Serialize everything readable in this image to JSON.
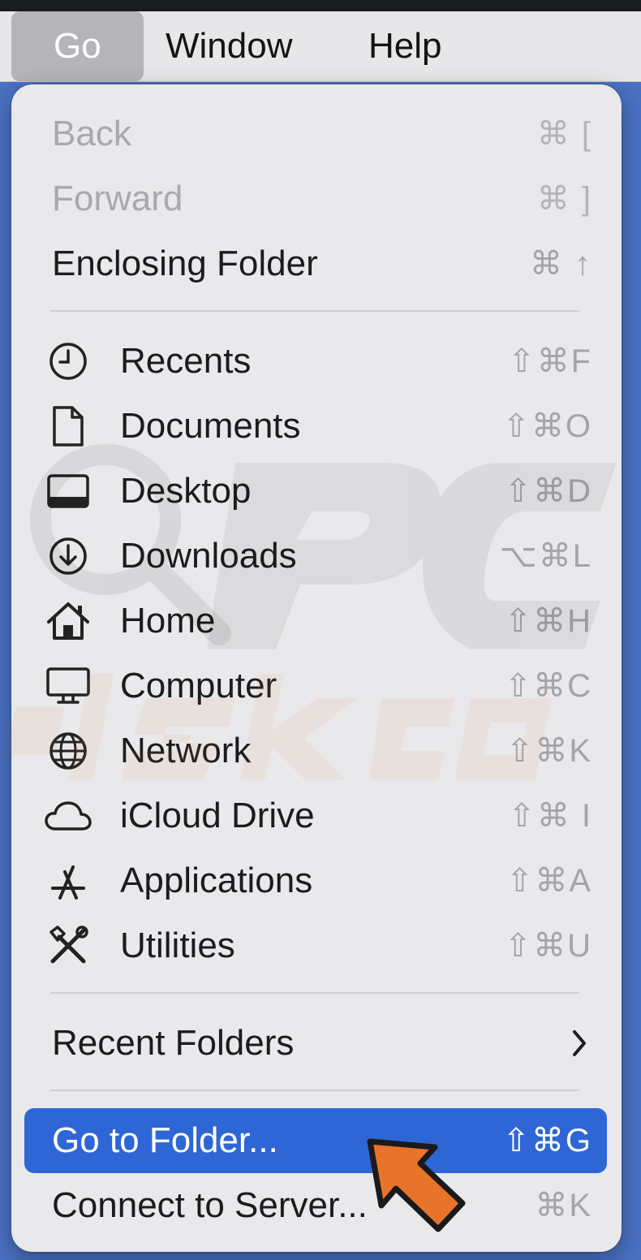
{
  "menubar": {
    "items": [
      {
        "label": "Go",
        "active": true
      },
      {
        "label": "Window"
      },
      {
        "label": "Help"
      }
    ]
  },
  "menu": {
    "items": [
      {
        "label": "Back",
        "shortcut": "⌘ [",
        "disabled": true
      },
      {
        "label": "Forward",
        "shortcut": "⌘ ]",
        "disabled": true
      },
      {
        "label": "Enclosing Folder",
        "shortcut": "⌘ ↑"
      },
      {
        "label": "Recents",
        "shortcut": "⇧⌘F",
        "icon": "clock-icon"
      },
      {
        "label": "Documents",
        "shortcut": "⇧⌘O",
        "icon": "document-icon"
      },
      {
        "label": "Desktop",
        "shortcut": "⇧⌘D",
        "icon": "desktop-icon"
      },
      {
        "label": "Downloads",
        "shortcut": "⌥⌘L",
        "icon": "download-icon"
      },
      {
        "label": "Home",
        "shortcut": "⇧⌘H",
        "icon": "house-icon"
      },
      {
        "label": "Computer",
        "shortcut": "⇧⌘C",
        "icon": "monitor-icon"
      },
      {
        "label": "Network",
        "shortcut": "⇧⌘K",
        "icon": "globe-icon"
      },
      {
        "label": "iCloud Drive",
        "shortcut": "⇧⌘ I",
        "icon": "cloud-icon"
      },
      {
        "label": "Applications",
        "shortcut": "⇧⌘A",
        "icon": "applications-icon"
      },
      {
        "label": "Utilities",
        "shortcut": "⇧⌘U",
        "icon": "tools-icon"
      },
      {
        "label": "Recent Folders",
        "submenu": true,
        "icon": "chevron-right-icon"
      },
      {
        "label": "Go to Folder...",
        "shortcut": "⇧⌘G",
        "selected": true
      },
      {
        "label": "Connect to Server...",
        "shortcut": "⌘K"
      }
    ]
  },
  "watermark": {
    "text": "PCrisk.com"
  },
  "annotation": {
    "icon": "orange-arrow-icon",
    "color": "#e8732a"
  },
  "colors": {
    "menubar": "#e7e7e9",
    "menu_background": "#e9e9eb",
    "selection": "#2f66d6",
    "desktop": "#4a72c4"
  }
}
